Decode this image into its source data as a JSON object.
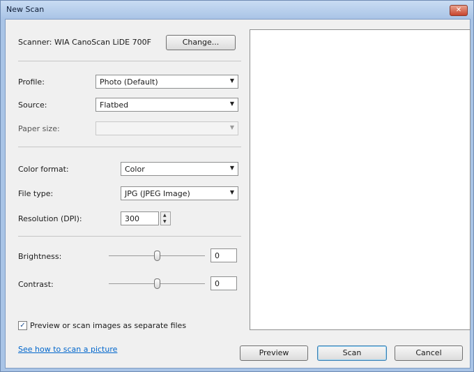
{
  "window": {
    "title": "New Scan",
    "close_glyph": "✕"
  },
  "scanner": {
    "label": "Scanner: WIA CanoScan LiDE 700F",
    "change_button": "Change..."
  },
  "profile": {
    "label": "Profile:",
    "value": "Photo (Default)"
  },
  "source": {
    "label": "Source:",
    "value": "Flatbed"
  },
  "paper_size": {
    "label": "Paper size:",
    "value": ""
  },
  "color_format": {
    "label": "Color format:",
    "value": "Color"
  },
  "file_type": {
    "label": "File type:",
    "value": "JPG (JPEG Image)"
  },
  "resolution": {
    "label": "Resolution (DPI):",
    "value": "300"
  },
  "brightness": {
    "label": "Brightness:",
    "value": "0",
    "level": 0.5
  },
  "contrast": {
    "label": "Contrast:",
    "value": "0",
    "level": 0.5
  },
  "separate_files": {
    "label": "Preview or scan images as separate files",
    "checked": true,
    "check_glyph": "✓"
  },
  "help_link": "See how to scan a picture",
  "buttons": {
    "preview": "Preview",
    "scan": "Scan",
    "cancel": "Cancel"
  },
  "icons": {
    "dropdown": "chevron-down-icon",
    "spin_up": "spin-up-icon",
    "spin_down": "spin-down-icon"
  }
}
